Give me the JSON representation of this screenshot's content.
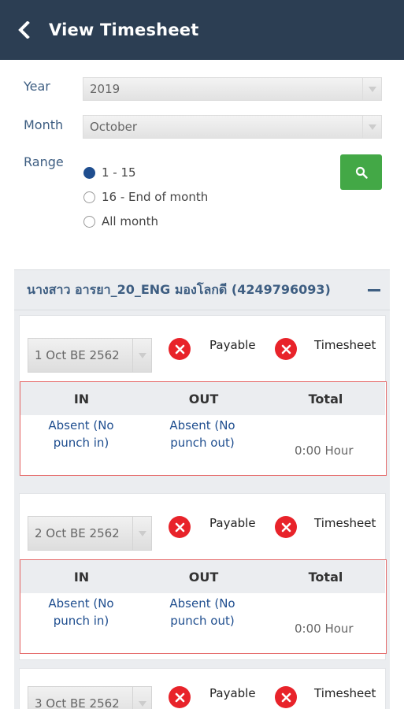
{
  "header": {
    "title": "View Timesheet"
  },
  "filters": {
    "year_label": "Year",
    "year_value": "2019",
    "month_label": "Month",
    "month_value": "October",
    "range_label": "Range",
    "range_options": [
      {
        "label": "1 - 15",
        "selected": true
      },
      {
        "label": "16 - End of month",
        "selected": false
      },
      {
        "label": "All month",
        "selected": false
      }
    ]
  },
  "employee": {
    "name": "นางสาว อารยา_20_ENG มองโลกดี (4249796093)"
  },
  "table_headers": {
    "in": "IN",
    "out": "OUT",
    "total": "Total"
  },
  "days": [
    {
      "date": "1 Oct BE 2562",
      "payable_label": "Payable",
      "timesheet_label": "Timesheet",
      "in": "Absent (No punch in)",
      "out": "Absent (No punch out)",
      "total": "0:00 Hour"
    },
    {
      "date": "2 Oct BE 2562",
      "payable_label": "Payable",
      "timesheet_label": "Timesheet",
      "in": "Absent (No punch in)",
      "out": "Absent (No punch out)",
      "total": "0:00 Hour"
    },
    {
      "date": "3 Oct BE 2562",
      "payable_label": "Payable",
      "timesheet_label": "Timesheet"
    }
  ],
  "colors": {
    "header_bg": "#2c3e53",
    "label_blue": "#3e5e82",
    "link_blue": "#1f4e8f",
    "search_green": "#43a846",
    "status_red": "#e8232a",
    "table_border": "#e56a6a"
  },
  "icons": {
    "back": "chevron-left-icon",
    "search": "search-icon",
    "status": "x-circle-icon",
    "collapse": "minus-icon",
    "dropdown": "chevron-down-icon"
  }
}
